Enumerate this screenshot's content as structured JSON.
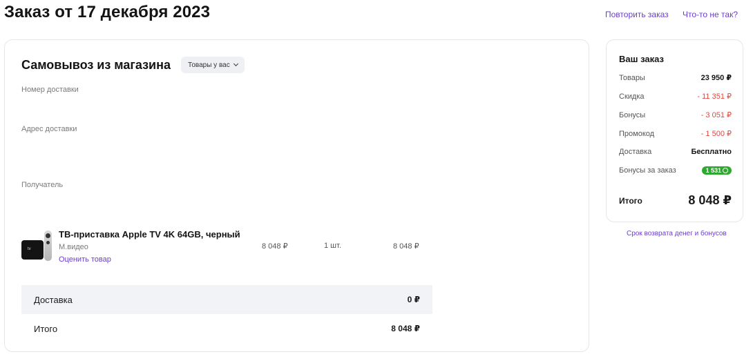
{
  "header": {
    "title": "Заказ от 17 декабря 2023",
    "repeat_link": "Повторить заказ",
    "problem_link": "Что-то не так?"
  },
  "delivery": {
    "title": "Самовывоз из магазина",
    "status_badge": "Товары у вас",
    "number_label": "Номер доставки",
    "address_label": "Адрес доставки",
    "recipient_label": "Получатель"
  },
  "product": {
    "image_text": "tv",
    "name": "ТВ-приставка Apple TV 4K 64GB, черный",
    "seller": "М.видео",
    "rate_link": "Оценить товар",
    "price": "8 048 ₽",
    "qty": "1 шт.",
    "total": "8 048 ₽"
  },
  "summary": {
    "delivery_label": "Доставка",
    "delivery_value": "0 ₽",
    "total_label": "Итого",
    "total_value": "8 048 ₽"
  },
  "side": {
    "title": "Ваш заказ",
    "rows": [
      {
        "label": "Товары",
        "value": "23 950 ₽"
      },
      {
        "label": "Скидка",
        "value": "- 11 351 ₽"
      },
      {
        "label": "Бонусы",
        "value": "- 3 051 ₽"
      },
      {
        "label": "Промокод",
        "value": "- 1 500 ₽"
      },
      {
        "label": "Доставка",
        "value": "Бесплатно"
      },
      {
        "label": "Бонусы за заказ",
        "value": "1 531"
      }
    ],
    "total_label": "Итого",
    "total_value": "8 048 ₽",
    "refund_link": "Срок возврата денег и бонусов"
  },
  "colors": {
    "accent": "#6a3fc9",
    "negative": "#e2453c",
    "bonus": "#2ea82f"
  }
}
